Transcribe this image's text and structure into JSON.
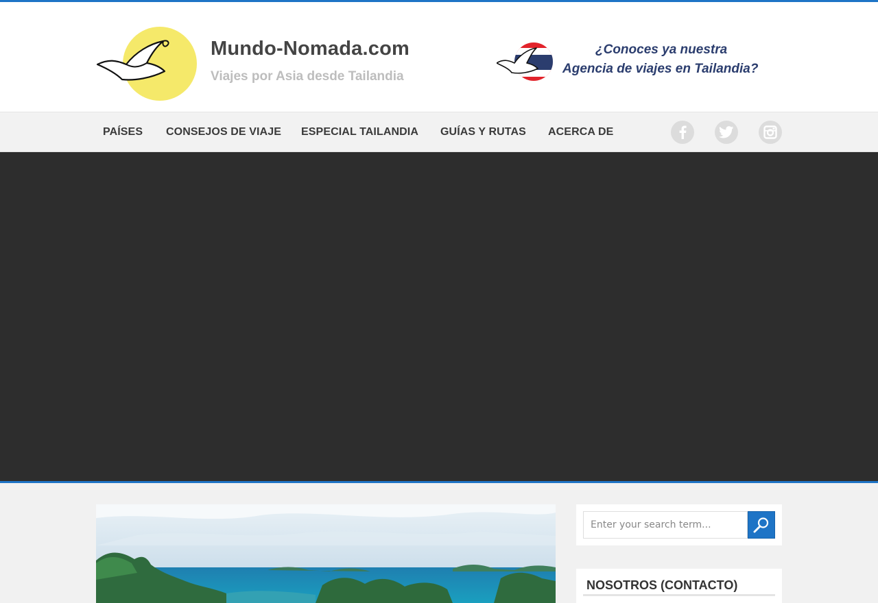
{
  "header": {
    "site_title": "Mundo-Nomada.com",
    "tagline": "Viajes por Asia desde Tailandia",
    "logo_icon": "bird-moon-logo-icon",
    "logo_color": "#f5e96a"
  },
  "ad_banner": {
    "line1": "¿Conoces ya nuestra",
    "line2": "Agencia de viajes en Tailandia?",
    "icon": "bird-thai-flag-icon",
    "text_color": "#2b3d6e"
  },
  "nav": {
    "items": [
      {
        "label": "PAÍSES"
      },
      {
        "label": "CONSEJOS DE VIAJE"
      },
      {
        "label": "ESPECIAL TAILANDIA"
      },
      {
        "label": "GUÍAS Y RUTAS"
      },
      {
        "label": "ACERCA DE"
      }
    ],
    "social": [
      "facebook-icon",
      "twitter-icon",
      "instagram-icon"
    ]
  },
  "search": {
    "placeholder": "Enter your search term..."
  },
  "sidebar": {
    "contact_title": "NOSOTROS (CONTACTO)"
  },
  "colors": {
    "accent": "#1e74c6",
    "hero_bg": "#2d2d2d",
    "nav_bg": "#f2f2f2"
  }
}
